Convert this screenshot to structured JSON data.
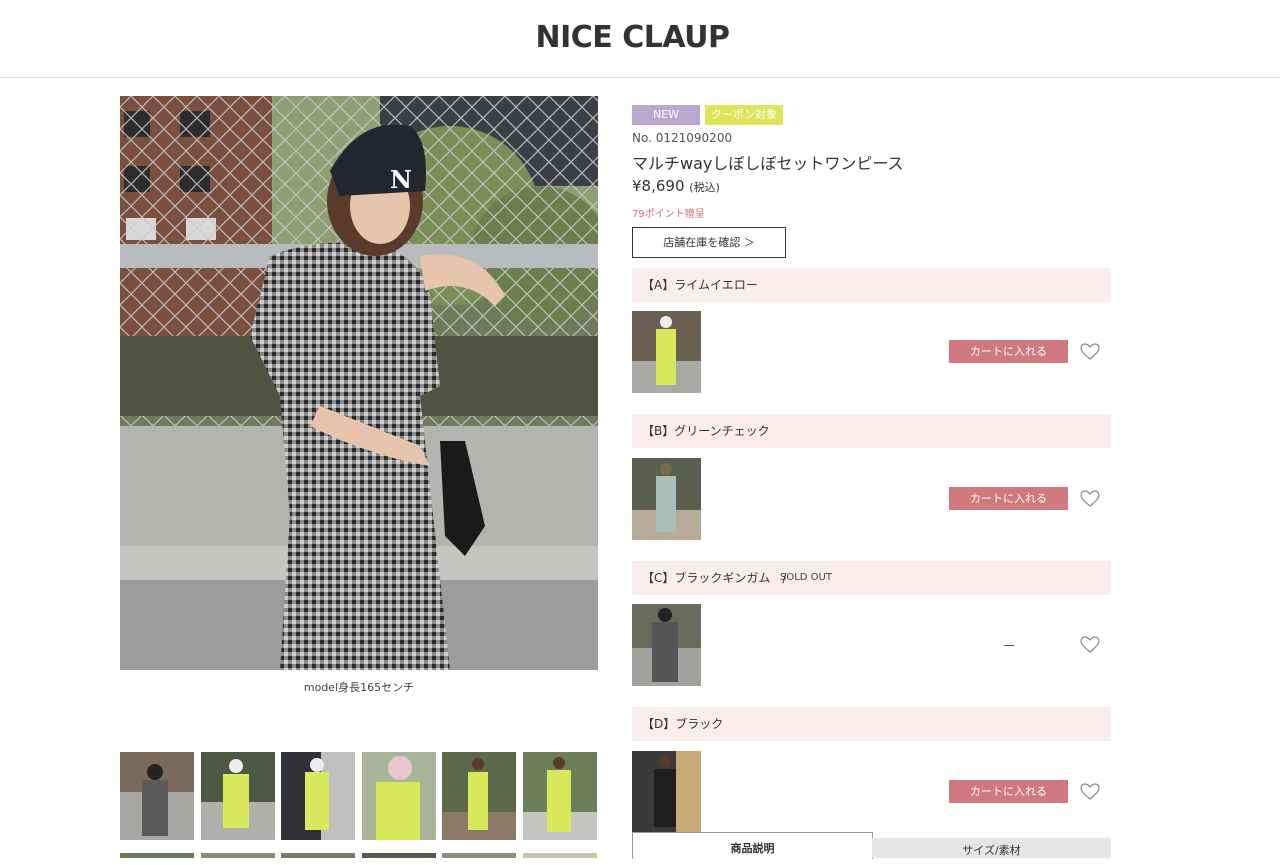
{
  "header": {
    "logo": "NICE CLAUP"
  },
  "gallery": {
    "caption": "model身長165センチ",
    "thumbnails": [
      "gingham-front",
      "lime-bag",
      "lime-shop",
      "lime-pink-cap",
      "lime-bench",
      "lime-street"
    ]
  },
  "product": {
    "badge_new": "NEW",
    "badge_coupon": "クーポン対象",
    "item_no": "No. 0121090200",
    "title": "マルチwayしぼしぼセットワンピース",
    "price": "¥8,690",
    "tax_note": "(税込)",
    "points": "79ポイント贈呈",
    "store_stock_button": "店舗在庫を確認 ＞"
  },
  "variants": [
    {
      "label": "【A】ライムイエロー",
      "status": "",
      "cart_label": "カートに入れる",
      "sold_out": false
    },
    {
      "label": "【B】グリーンチェック",
      "status": "",
      "cart_label": "カートに入れる",
      "sold_out": false
    },
    {
      "label": "【C】ブラックギンガム　/",
      "status": "SOLD OUT",
      "cart_label": "－",
      "sold_out": true
    },
    {
      "label": "【D】ブラック",
      "status": "",
      "cart_label": "カートに入れる",
      "sold_out": false
    }
  ],
  "tabs": [
    {
      "label": "商品説明",
      "active": true
    },
    {
      "label": "サイズ/素材",
      "active": false
    }
  ],
  "colors": {
    "accent_pink": "#d07a80",
    "variant_bg": "#fbedee",
    "badge_new": "#b9a7cf",
    "badge_coupon": "#e0e45a",
    "points_text": "#d16f7a"
  }
}
